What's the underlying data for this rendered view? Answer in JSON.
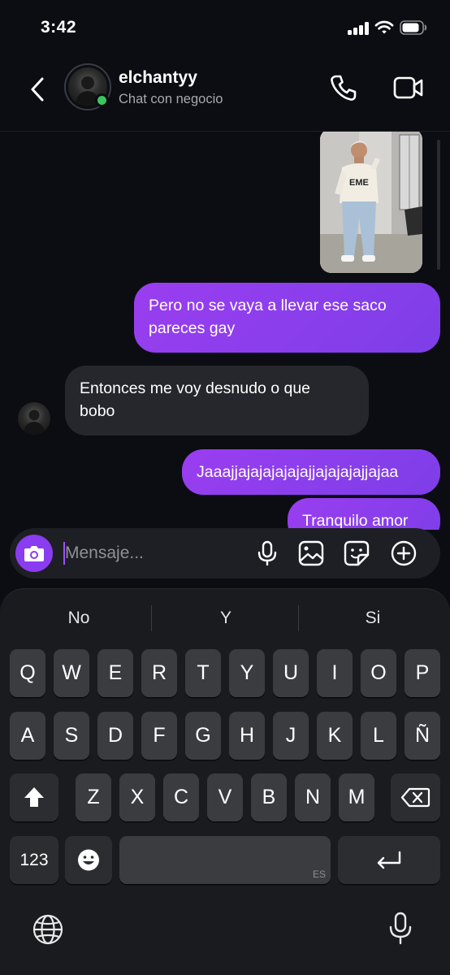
{
  "status": {
    "time": "3:42"
  },
  "header": {
    "name": "elchantyy",
    "subtitle": "Chat con negocio"
  },
  "messages": [
    {
      "kind": "image",
      "direction": "outgoing"
    },
    {
      "kind": "text",
      "direction": "outgoing",
      "lines": [
        "Pero no se vaya a llevar ese saco",
        "pareces gay"
      ]
    },
    {
      "kind": "text",
      "direction": "incoming",
      "lines": [
        "Entonces me voy desnudo o que",
        "bobo"
      ]
    },
    {
      "kind": "text",
      "direction": "outgoing",
      "lines": [
        "Jaaajjajajajajajajjajajajajjajaa"
      ]
    },
    {
      "kind": "text",
      "direction": "outgoing",
      "lines": [
        "Tranquilo amor"
      ]
    }
  ],
  "composer": {
    "placeholder": "Mensaje..."
  },
  "keyboard": {
    "suggestions": [
      "No",
      "Y",
      "Si"
    ],
    "row1": [
      "Q",
      "W",
      "E",
      "R",
      "T",
      "Y",
      "U",
      "I",
      "O",
      "P"
    ],
    "row2": [
      "A",
      "S",
      "D",
      "F",
      "G",
      "H",
      "J",
      "K",
      "L",
      "Ñ"
    ],
    "row3": [
      "Z",
      "X",
      "C",
      "V",
      "B",
      "N",
      "M"
    ],
    "numbers_label": "123",
    "space_lang": "ES"
  },
  "colors": {
    "accent": "#8a3cf0",
    "outgoing_bubble": "#8b3ff0",
    "incoming_bubble": "#26272c",
    "online": "#3ac55d"
  },
  "icons": [
    "back-icon",
    "phone-icon",
    "video-icon",
    "camera-icon",
    "mic-icon",
    "gallery-icon",
    "sticker-icon",
    "plus-icon",
    "shift-icon",
    "backspace-icon",
    "emoji-icon",
    "return-icon",
    "globe-icon",
    "dictation-icon"
  ]
}
